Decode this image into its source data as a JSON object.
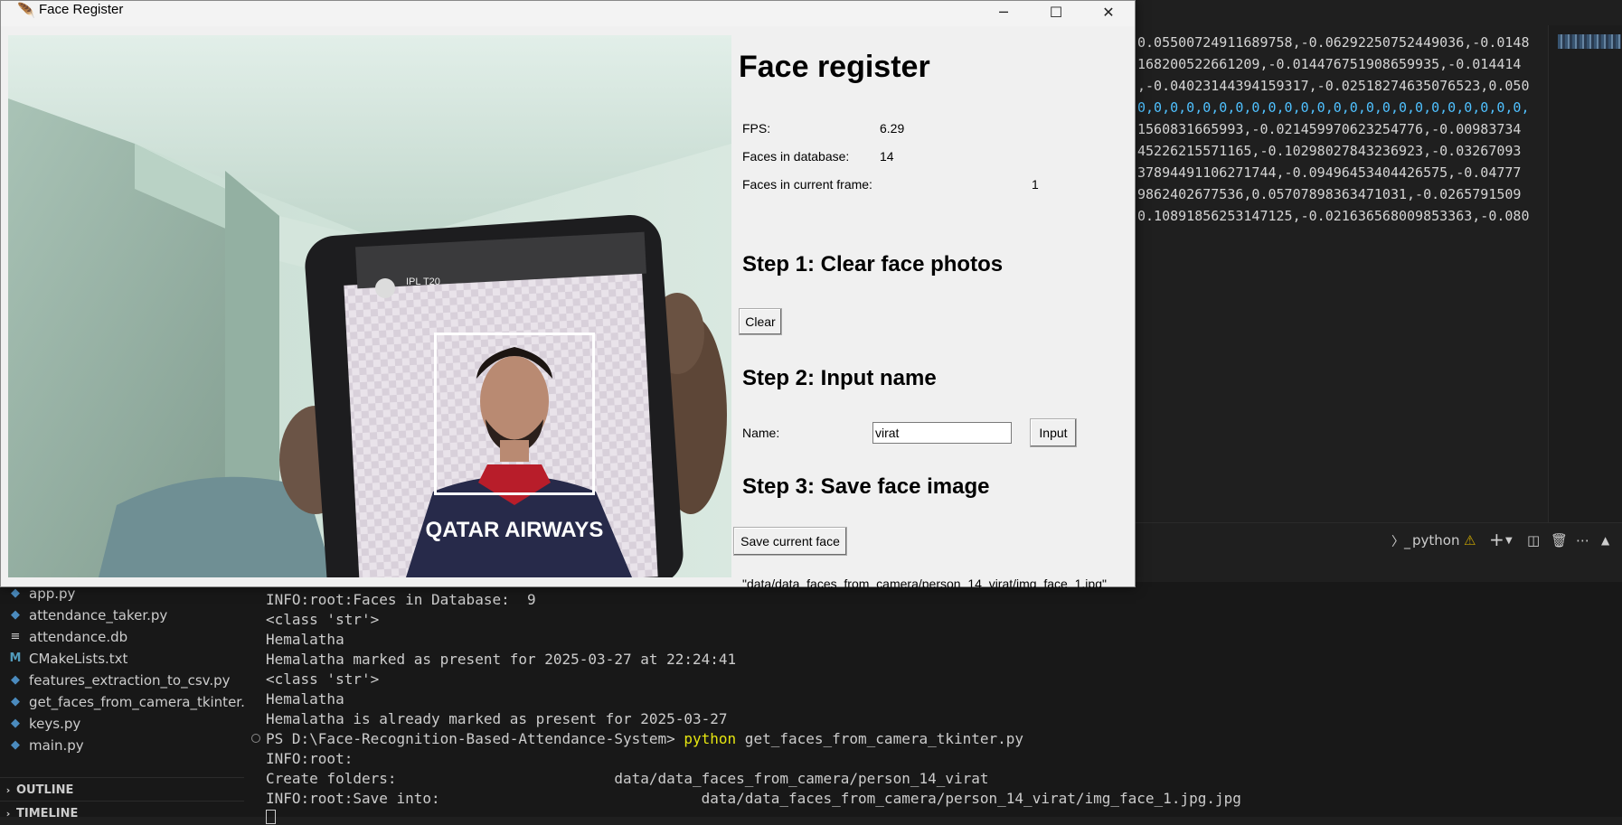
{
  "editor": {
    "lines": [
      "0.05500724911689758,-0.06292250752449036,-0.0148",
      "168200522661209,-0.014476751908659935,-0.014414",
      ",-0.04023144394159317,-0.02518274635076523,0.050",
      "0,0,0,0,0,0,0,0,0,0,0,0,0,0,0,0,0,0,0,0,0,0,0,0,",
      "1560831665993,-0.021459970623254776,-0.00983734",
      "45226215571165,-0.10298027843236923,-0.03267093",
      "37894491106271744,-0.09496453404426575,-0.04777",
      "9862402677536,0.05707898363471031,-0.0265791509",
      "0.10891856253147125,-0.021636568009853363,-0.080"
    ]
  },
  "panel": {
    "terminal_label": "python",
    "warning_icon": "warning-icon",
    "add_icon": "plus-icon",
    "split_icon": "split-icon",
    "trash_icon": "trash-icon",
    "more_icon": "ellipsis-icon"
  },
  "explorer": {
    "files": [
      {
        "name": "app.py",
        "icon": "python-file-icon"
      },
      {
        "name": "attendance_taker.py",
        "icon": "python-file-icon"
      },
      {
        "name": "attendance.db",
        "icon": "text-file-icon"
      },
      {
        "name": "CMakeLists.txt",
        "icon": "cmake-file-icon"
      },
      {
        "name": "features_extraction_to_csv.py",
        "icon": "python-file-icon"
      },
      {
        "name": "get_faces_from_camera_tkinter...",
        "icon": "python-file-icon"
      },
      {
        "name": "keys.py",
        "icon": "python-file-icon"
      },
      {
        "name": "main.py",
        "icon": "python-file-icon"
      }
    ],
    "outline_label": "OUTLINE",
    "timeline_label": "TIMELINE"
  },
  "terminal": {
    "lines": [
      "INFO:root:Faces in Database:  9",
      "<class 'str'>",
      "Hemalatha",
      "Hemalatha marked as present for 2025-03-27 at 22:24:41",
      "<class 'str'>",
      "Hemalatha",
      "Hemalatha is already marked as present for 2025-03-27"
    ],
    "prompt": "PS D:\\Face-Recognition-Based-Attendance-System> ",
    "command": "python",
    "command_args": " get_faces_from_camera_tkinter.py",
    "after": [
      "INFO:root:",
      "Create folders:                         data/data_faces_from_camera/person_14_virat",
      "INFO:root:Save into:                              data/data_faces_from_camera/person_14_virat/img_face_1.jpg.jpg"
    ]
  },
  "window": {
    "title": "Face Register",
    "minimize_symbol": "─",
    "maximize_symbol": "☐",
    "close_symbol": "✕"
  },
  "app": {
    "heading": "Face register",
    "fps_label": "FPS:",
    "fps_value": "6.29",
    "db_label": "Faces in database:",
    "db_value": "14",
    "frame_label": "Faces in current frame:",
    "frame_value": "1",
    "step1": "Step 1: Clear face photos",
    "clear_button": "Clear",
    "step2": "Step 2: Input name",
    "name_label": "Name:",
    "name_value": "virat",
    "input_button": "Input",
    "step3": "Step 3: Save face image",
    "save_button": "Save current face",
    "save_path_partial": "\"data/data_faces_from_camera/person_14_virat/img_face_1.jpg\""
  },
  "camera": {
    "phone_app_label": "IPL T20",
    "jersey_text": "QATAR AIRWAYS"
  }
}
